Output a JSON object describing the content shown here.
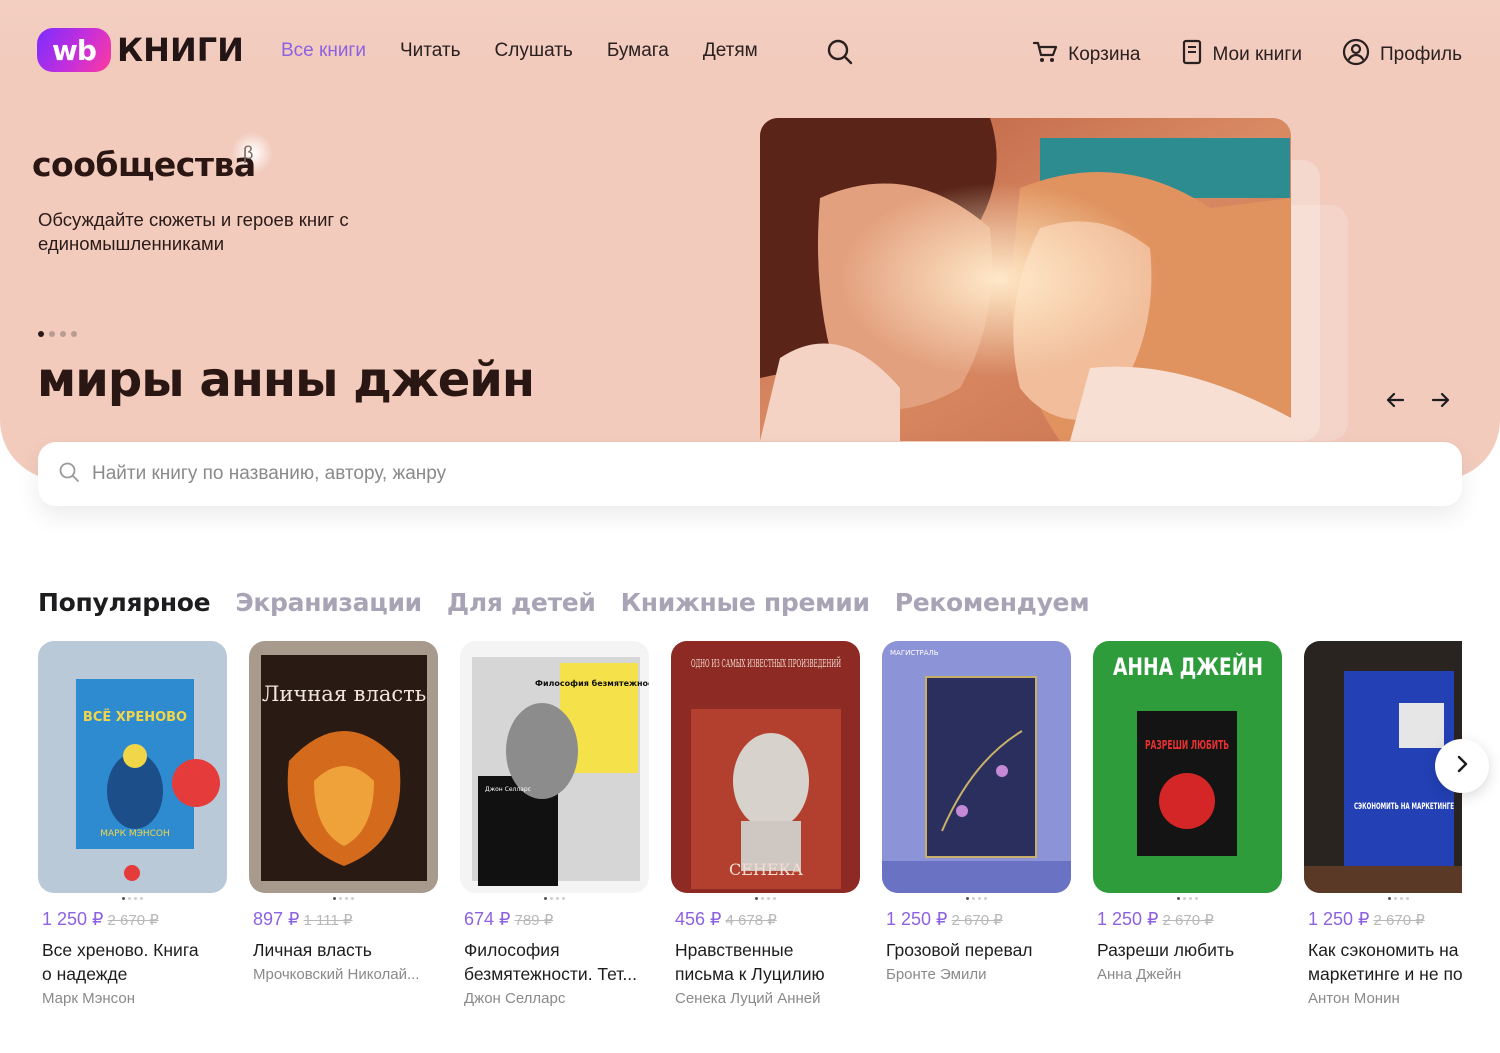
{
  "header": {
    "logo_badge": "wb",
    "logo_text": "КНИГИ",
    "nav": [
      "Все книги",
      "Читать",
      "Слушать",
      "Бумага",
      "Детям"
    ],
    "cart": "Корзина",
    "my_books": "Мои книги",
    "profile": "Профиль"
  },
  "hero": {
    "community_label": "сообщества",
    "beta_mark": "β",
    "description": "Обсуждайте сюжеты и героев книг с единомышленниками",
    "title": "миры анны джейн",
    "slide_count": 4,
    "active_slide": 1
  },
  "search": {
    "placeholder": "Найти книгу по названию, автору, жанру"
  },
  "tabs": [
    "Популярное",
    "Экранизации",
    "Для детей",
    "Книжные премии",
    "Рекомендуем"
  ],
  "colors": {
    "accent": "#8d62e0",
    "hero_bg": "#f2cbbd"
  },
  "books": [
    {
      "price": "1 250 ₽",
      "old_price": "2 670 ₽",
      "title_line1": "Все хреново. Книга",
      "title_line2": "о надежде",
      "author": "Марк Мэнсон",
      "cover_text": "ВСЁ ХРЕНОВО",
      "cover_sub": "МАРК МЭНСОН"
    },
    {
      "price": "897 ₽",
      "old_price": "1 111 ₽",
      "title_line1": "Личная власть",
      "title_line2": "",
      "author": "Мрочковский Николай...",
      "cover_text": "Личная власть",
      "cover_sub": ""
    },
    {
      "price": "674 ₽",
      "old_price": "789 ₽",
      "title_line1": "Философия",
      "title_line2": "безмятежности. Тет...",
      "author": "Джон Селларс",
      "cover_text": "Философия безмятежности",
      "cover_sub": "Джон Селларс"
    },
    {
      "price": "456 ₽",
      "old_price": "4 678 ₽",
      "title_line1": "Нравственные",
      "title_line2": "письма к Луцилию",
      "author": "Сенека Луций Анней",
      "cover_text": "ОДНО ИЗ САМЫХ ИЗВЕСТНЫХ ПРОИЗВЕДЕНИЙ",
      "cover_sub": "СЕНЕКА"
    },
    {
      "price": "1 250 ₽",
      "old_price": "2 670 ₽",
      "title_line1": "Грозовой перевал",
      "title_line2": "",
      "author": "Бронте Эмили",
      "cover_text": "МАГИСТРАЛЬ",
      "cover_sub": ""
    },
    {
      "price": "1 250 ₽",
      "old_price": "2 670 ₽",
      "title_line1": "Разреши любить",
      "title_line2": "",
      "author": "Анна Джейн",
      "cover_text": "АННА ДЖЕЙН",
      "cover_sub": "РАЗРЕШИ ЛЮБИТЬ"
    },
    {
      "price": "1 250 ₽",
      "old_price": "2 670 ₽",
      "title_line1": "Как сэкономить на",
      "title_line2": "маркетинге и не по",
      "author": "Антон Монин",
      "cover_text": "СЭКОНОМИТЬ НА МАРКЕТИНГЕ",
      "cover_sub": ""
    }
  ]
}
